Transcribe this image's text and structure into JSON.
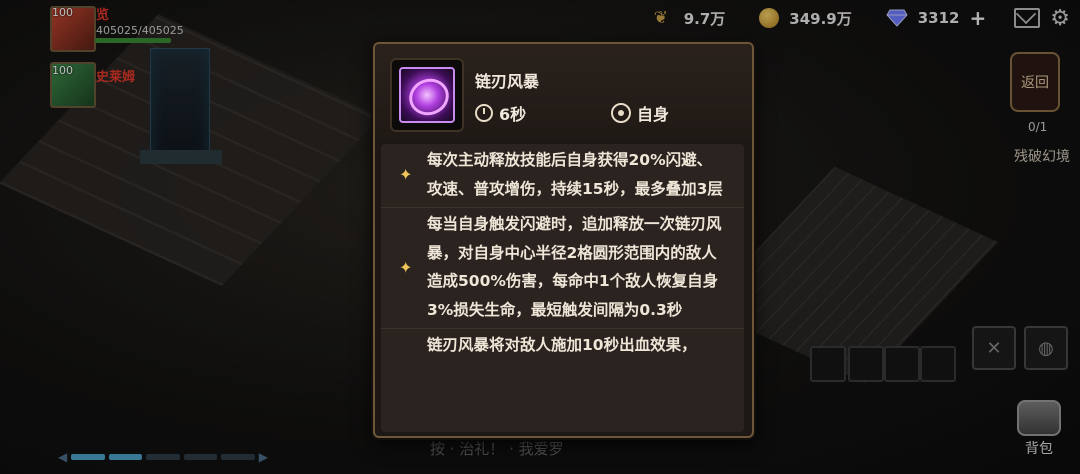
{
  "top_bar": {
    "wheat_value": "9.7万",
    "coin_value": "349.9万",
    "gem_value": "3312",
    "plus_symbol": "+"
  },
  "party": [
    {
      "level": "100",
      "name": "览",
      "hp": "405025/405025"
    },
    {
      "level": "100",
      "name": "史莱姆"
    }
  ],
  "tooltip": {
    "skill_name": "链刃风暴",
    "cooldown": "6秒",
    "target": "自身",
    "effects": [
      "每次主动释放技能后自身获得20%闪避、攻速、普攻增伤，持续15秒，最多叠加3层",
      "每当自身触发闪避时，追加释放一次链刃风暴，对自身中心半径2格圆形范围内的敌人造成500%伤害，每命中1个敌人恢复自身3%损失生命，最短触发间隔为0.3秒",
      "链刃风暴将对敌人施加10秒出血效果，"
    ],
    "star_glyph": "✦"
  },
  "right_panel": {
    "back_label": "返回",
    "counter": "0/1",
    "zone_name": "残破幻境",
    "bag_label": "背包"
  },
  "chat_hint": "按 · 治礼！ · 我爱罗",
  "icons": {
    "wheat": "wheat-icon",
    "coin": "coin-icon",
    "gem": "gem-icon",
    "mail": "mail-icon",
    "settings": "gear-icon"
  },
  "colors": {
    "tooltip_border": "#6e5738",
    "star": "#f1c45a",
    "skill_glow": "#b13fe0"
  }
}
